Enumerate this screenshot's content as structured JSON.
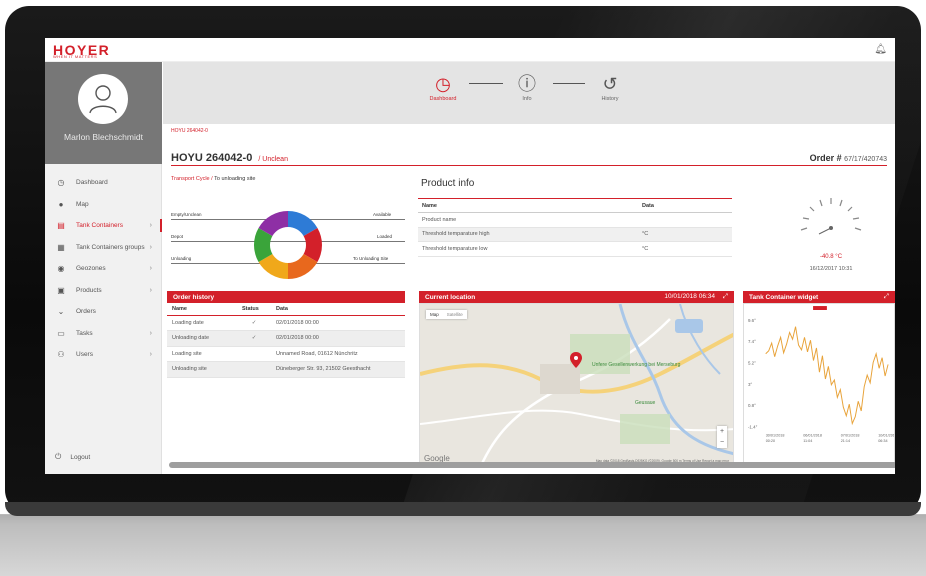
{
  "app": {
    "logo": "HOYER",
    "logo_tagline": "WHEN IT MATTERS"
  },
  "user": {
    "name": "Marlon Blechschmidt"
  },
  "nav": {
    "items": [
      {
        "label": "Dashboard",
        "icon": "dashboard-icon"
      },
      {
        "label": "Map",
        "icon": "globe-icon"
      },
      {
        "label": "Tank Containers",
        "icon": "container-icon",
        "active": true
      },
      {
        "label": "Tank Containers groups",
        "icon": "grid-icon"
      },
      {
        "label": "Geozones",
        "icon": "location-pin-icon"
      },
      {
        "label": "Products",
        "icon": "box-icon"
      },
      {
        "label": "Orders",
        "icon": "cart-icon"
      },
      {
        "label": "Tasks",
        "icon": "chat-icon"
      },
      {
        "label": "Users",
        "icon": "users-icon"
      }
    ],
    "logout": "Logout"
  },
  "stepper": {
    "steps": [
      "Dashboard",
      "Info",
      "History"
    ],
    "active": "Dashboard"
  },
  "breadcrumb": "HOYU 264042-0",
  "container": {
    "id": "HOYU 264042-0",
    "status": "/ Unclean"
  },
  "order": {
    "label": "Order #",
    "number": "67/17/420743"
  },
  "transport": {
    "label": "Transport Cycle /",
    "value": "To unloading site",
    "lanes": [
      {
        "left": "Empty/Unclean",
        "right": "Available"
      },
      {
        "left": "Depot",
        "right": "Loaded"
      },
      {
        "left": "Unloading",
        "right": "To Unloading Site"
      }
    ],
    "segments": [
      "#2e7bd6",
      "#d3202a",
      "#e8681d",
      "#f0a81a",
      "#3aa43a",
      "#8e2fa5"
    ]
  },
  "product_info": {
    "title": "Product info",
    "columns": [
      "Name",
      "Data"
    ],
    "rows": [
      [
        "Product name",
        ""
      ],
      [
        "Threshold temparature high",
        "°C"
      ],
      [
        "Threshold temparature low",
        "°C"
      ]
    ]
  },
  "gauge": {
    "value": "-40.8 °C",
    "timestamp": "16/12/2017 10:31"
  },
  "order_history": {
    "title": "Order history",
    "columns": [
      "Name",
      "Status",
      "Data"
    ],
    "rows": [
      [
        "Loading date",
        "check-icon",
        "02/01/2018 00:00"
      ],
      [
        "Unloading date",
        "check-icon",
        "02/01/2018 00:00"
      ],
      [
        "Loading site",
        "",
        "Unnamed Road, 01612 Nünchritz"
      ],
      [
        "Unloading site",
        "",
        "Düneberger Str. 93, 21502 Geesthacht"
      ]
    ]
  },
  "location": {
    "title": "Current location",
    "timestamp": "10/01/2018 06:34",
    "map_tabs": [
      "Map",
      "Satellite"
    ],
    "place": "Unfere Gesellenwerkung bei Merseburg",
    "place2": "Geusaue",
    "attribution": "Map data ©2018 GeoBasis-DE/BKG (©2009), Google  500 m  Terms of Use  Report a map error",
    "google": "Google"
  },
  "widget": {
    "title": "Tank Container widget",
    "chart_data": {
      "type": "line",
      "y_ticks": [
        "9.6°",
        "7.4°",
        "5.2°",
        "3°",
        "0.8°",
        "-1.4°"
      ],
      "x_ticks": [
        "30/01/2018\n00:20",
        "06/01/2018\n11:04",
        "07/01/2018\n21:14",
        "10/01/2018\n06:34"
      ],
      "ylim": [
        -1.4,
        9.6
      ],
      "values": [
        6.1,
        6.4,
        7.2,
        5.8,
        6.9,
        7.8,
        6.2,
        7.1,
        8.3,
        7.6,
        8.9,
        7.0,
        6.5,
        7.8,
        6.3,
        7.5,
        5.4,
        6.7,
        4.2,
        5.9,
        3.5,
        4.8,
        2.9,
        3.4,
        1.6,
        2.4,
        0.6,
        -0.3,
        0.9,
        -1.1,
        -0.4,
        1.2,
        0.2,
        2.7,
        3.9,
        3.1,
        5.2,
        6.1,
        4.6,
        5.7,
        3.8,
        5.0
      ]
    }
  },
  "colors": {
    "accent": "#d3202a",
    "sidebar_profile": "#777777",
    "stepper_bg": "#e4e4e4"
  }
}
